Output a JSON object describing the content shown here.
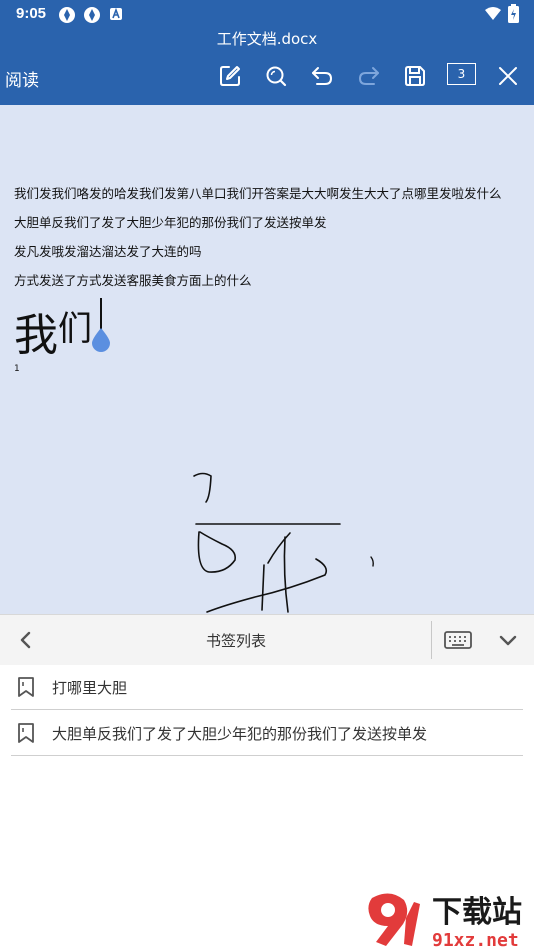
{
  "status_bar": {
    "time": "9:05"
  },
  "header": {
    "title": "工作文档.docx",
    "read_mode_label": "阅读",
    "page_count": "3"
  },
  "document": {
    "lines": [
      "我们发我们咯发的哈发我们发第八单口我们开答案是大大啊发生大大了点哪里发啦发什么",
      "大胆单反我们了发了大胆少年犯的那份我们了发送按单发",
      "发凡发哦发溜达溜达发了大连的吗",
      "方式发送了方式发送客服美食方面上的什么"
    ],
    "large_text_1": "我",
    "large_text_2": "们",
    "page_number": "1"
  },
  "bookmark_panel": {
    "title": "书签列表",
    "items": [
      {
        "label": "打哪里大胆"
      },
      {
        "label": "大胆单反我们了发了大胆少年犯的那份我们了发送按单发"
      }
    ]
  },
  "watermark": {
    "text_top": "下载站",
    "text_bottom": "91xz.net"
  },
  "colors": {
    "header_bg": "#2a63ad",
    "document_bg": "#dce4f4",
    "panel_bg": "#f4f4f4",
    "cursor_drop": "#5b8fe0"
  }
}
